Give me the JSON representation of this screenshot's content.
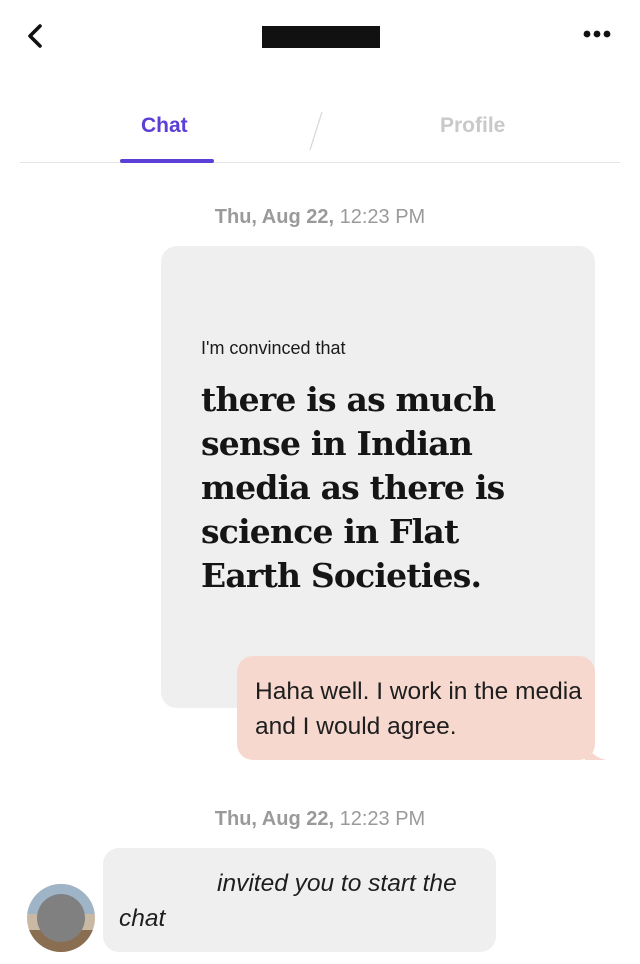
{
  "header": {
    "back_icon": "chevron-left-icon",
    "more_icon": "more-horizontal-icon"
  },
  "tabs": [
    {
      "label": "Chat",
      "active": true
    },
    {
      "label": "Profile",
      "active": false
    }
  ],
  "colors": {
    "accent": "#5b3fd6",
    "bubble_sent": "#f6d8cf",
    "bubble_received": "#efefef",
    "timestamp": "#9a9a9a"
  },
  "messages": [
    {
      "timestamp": {
        "date": "Thu, Aug 22,",
        "time": "12:23 PM"
      },
      "prompt": {
        "label": "I'm convinced that",
        "answer": "there is as much sense in Indian media as there is science in Flat Earth Societies."
      },
      "reply": "Haha well. I work in the media and I would agree."
    },
    {
      "timestamp": {
        "date": "Thu, Aug 22,",
        "time": "12:23 PM"
      },
      "invite": "invited you to start the chat"
    }
  ]
}
